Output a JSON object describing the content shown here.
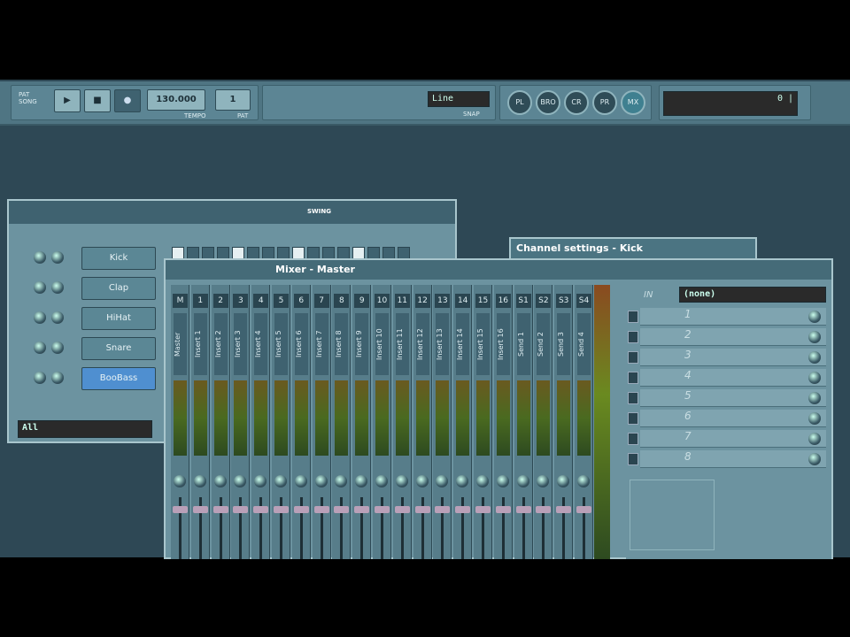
{
  "toolbar": {
    "song_mode": "PAT SONG",
    "play": "▶",
    "stop": "■",
    "record": "●",
    "tempo_display": "130.000",
    "tempo_label": "TEMPO",
    "pattern_display": "1",
    "pattern_label": "PAT",
    "snap_value": "Line",
    "snap_label": "SNAP",
    "panel_buttons": [
      "PL",
      "BRO",
      "CR",
      "PR",
      "MX"
    ],
    "hint_display": "0 |"
  },
  "channel_rack": {
    "swing_label": "SWING",
    "filter": "All",
    "channels": [
      {
        "label": "Kick"
      },
      {
        "label": "Clap"
      },
      {
        "label": "HiHat"
      },
      {
        "label": "Snare"
      },
      {
        "label": "BooBass"
      }
    ]
  },
  "channel_settings": {
    "title": "Channel settings - Kick"
  },
  "mixer": {
    "title": "Mixer - Master",
    "master": {
      "num": "M",
      "name": "Master"
    },
    "inserts": [
      {
        "num": "1",
        "name": "Insert 1"
      },
      {
        "num": "2",
        "name": "Insert 2"
      },
      {
        "num": "3",
        "name": "Insert 3"
      },
      {
        "num": "4",
        "name": "Insert 4"
      },
      {
        "num": "5",
        "name": "Insert 5"
      },
      {
        "num": "6",
        "name": "Insert 6"
      },
      {
        "num": "7",
        "name": "Insert 7"
      },
      {
        "num": "8",
        "name": "Insert 8"
      },
      {
        "num": "9",
        "name": "Insert 9"
      },
      {
        "num": "10",
        "name": "Insert 10"
      },
      {
        "num": "11",
        "name": "Insert 11"
      },
      {
        "num": "12",
        "name": "Insert 12"
      },
      {
        "num": "13",
        "name": "Insert 13"
      },
      {
        "num": "14",
        "name": "Insert 14"
      },
      {
        "num": "15",
        "name": "Insert 15"
      },
      {
        "num": "16",
        "name": "Insert 16"
      },
      {
        "num": "S1",
        "name": "Send 1"
      },
      {
        "num": "S2",
        "name": "Send 2"
      },
      {
        "num": "S3",
        "name": "Send 3"
      },
      {
        "num": "S4",
        "name": "Send 4"
      }
    ],
    "fx": {
      "input_label": "IN",
      "input_value": "(none)",
      "slots": [
        "1",
        "2",
        "3",
        "4",
        "5",
        "6",
        "7",
        "8"
      ]
    }
  }
}
